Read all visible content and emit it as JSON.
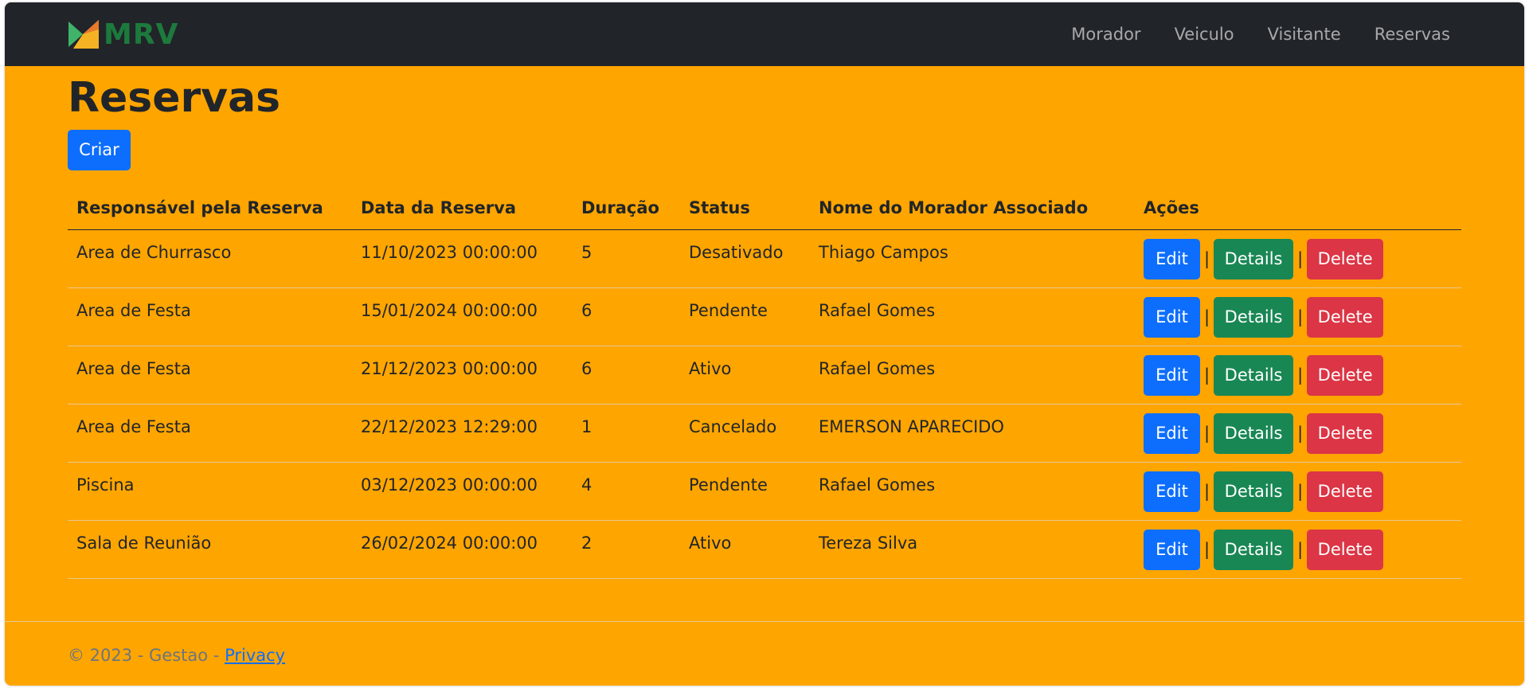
{
  "navbar": {
    "brand": "MRV",
    "links": [
      "Morador",
      "Veiculo",
      "Visitante",
      "Reservas"
    ]
  },
  "page": {
    "title": "Reservas",
    "create_label": "Criar"
  },
  "table": {
    "headers": [
      "Responsável pela Reserva",
      "Data da Reserva",
      "Duração",
      "Status",
      "Nome do Morador Associado",
      "Ações"
    ],
    "rows": [
      [
        "Area de Churrasco",
        "11/10/2023 00:00:00",
        "5",
        "Desativado",
        "Thiago Campos"
      ],
      [
        "Area de Festa",
        "15/01/2024 00:00:00",
        "6",
        "Pendente",
        "Rafael Gomes"
      ],
      [
        "Area de Festa",
        "21/12/2023 00:00:00",
        "6",
        "Ativo",
        "Rafael Gomes"
      ],
      [
        "Area de Festa",
        "22/12/2023 12:29:00",
        "1",
        "Cancelado",
        "EMERSON APARECIDO"
      ],
      [
        "Piscina",
        "03/12/2023 00:00:00",
        "4",
        "Pendente",
        "Rafael Gomes"
      ],
      [
        "Sala de Reunião",
        "26/02/2024 00:00:00",
        "2",
        "Ativo",
        "Tereza Silva"
      ]
    ],
    "actions": {
      "edit": "Edit",
      "details": "Details",
      "delete": "Delete",
      "separator": "|"
    }
  },
  "footer": {
    "text": "© 2023 - Gestao - ",
    "privacy_label": "Privacy"
  },
  "colors": {
    "background": "#ffa500",
    "navbar": "#212529",
    "primary": "#0d6efd",
    "success": "#198754",
    "danger": "#dc3545",
    "brand_green": "#1d7a3d"
  }
}
